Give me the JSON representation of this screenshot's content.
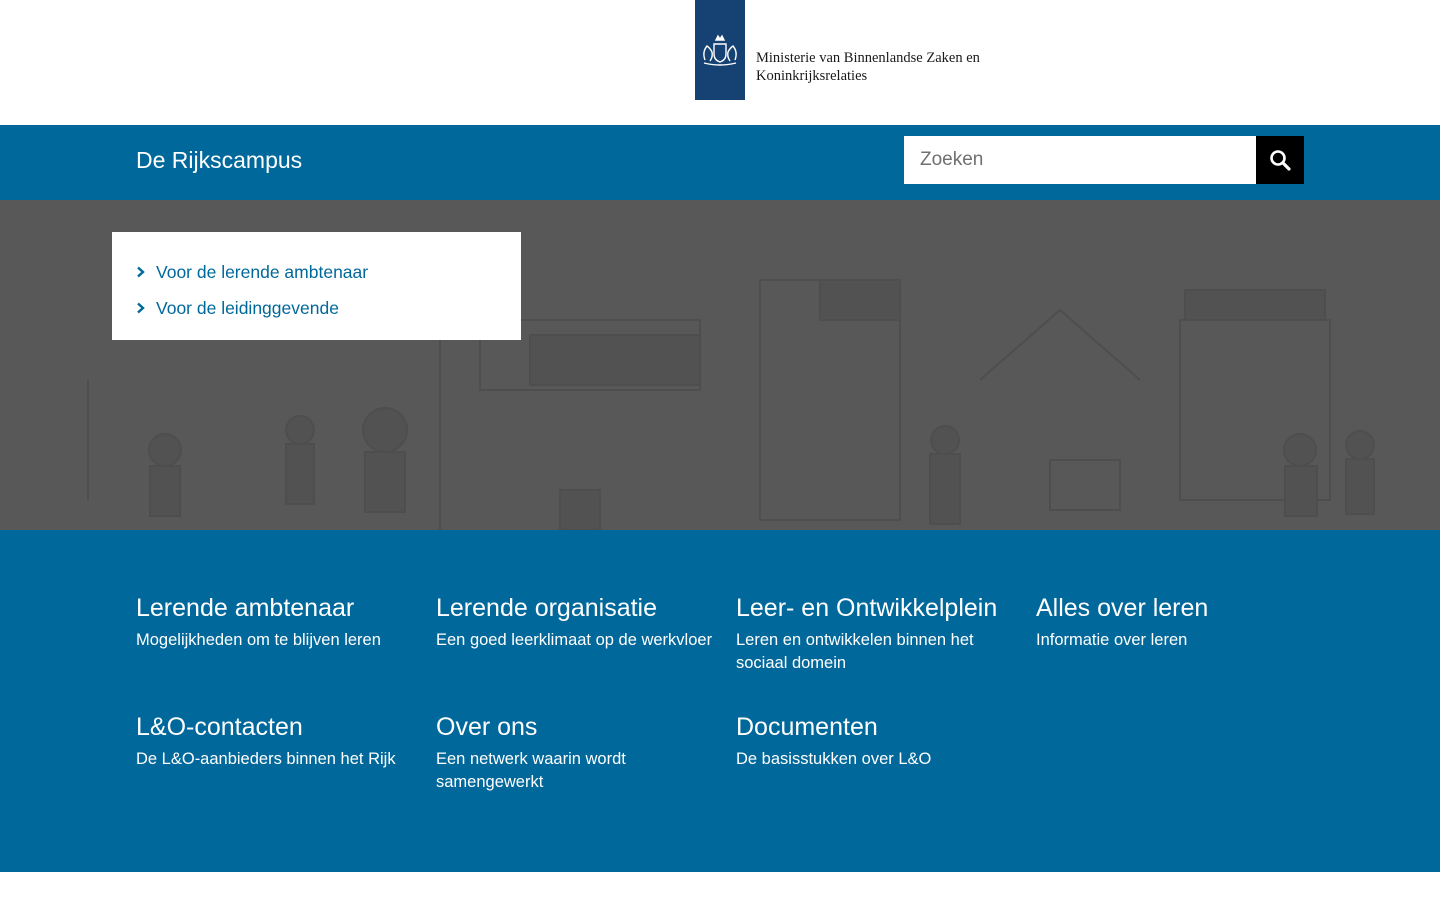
{
  "brand": {
    "ministry_line1": "Ministerie van Binnenlandse Zaken en",
    "ministry_line2": "Koninkrijksrelaties",
    "logo_icon": "coat-of-arms-icon",
    "color": "#154273"
  },
  "header": {
    "site_title": "De Rijkscampus",
    "bar_color": "#01689b"
  },
  "search": {
    "placeholder": "Zoeken",
    "value": "",
    "button_icon": "search-icon"
  },
  "hero": {
    "links": [
      {
        "label": "Voor de lerende ambtenaar",
        "icon": "chevron-right-icon"
      },
      {
        "label": "Voor de leidinggevende",
        "icon": "chevron-right-icon"
      }
    ]
  },
  "tiles": [
    {
      "title": "Lerende ambtenaar",
      "description": "Mogelijkheden om te blijven leren"
    },
    {
      "title": "Lerende organisatie",
      "description": "Een goed leerklimaat op de werkvloer"
    },
    {
      "title": "Leer- en Ontwikkelplein",
      "description": "Leren en ontwikkelen binnen het sociaal domein"
    },
    {
      "title": "Alles over leren",
      "description": "Informatie over leren"
    },
    {
      "title": "L&O-contacten",
      "description": "De L&O-aanbieders binnen het Rijk"
    },
    {
      "title": "Over ons",
      "description": "Een netwerk waarin wordt samengewerkt"
    },
    {
      "title": "Documenten",
      "description": "De basisstukken over L&O"
    }
  ]
}
